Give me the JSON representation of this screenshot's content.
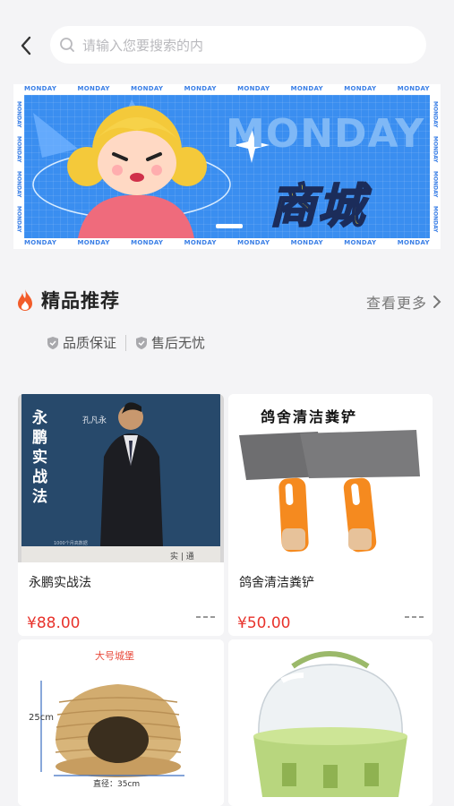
{
  "search": {
    "placeholder": "请输入您要搜索的内"
  },
  "banner": {
    "strip_word": "MONDAY",
    "headline": "MONDAY",
    "title": "商城"
  },
  "section": {
    "title": "精品推荐",
    "see_more": "查看更多",
    "badges": [
      "品质保证",
      "售后无忧"
    ]
  },
  "products": [
    {
      "name": "永鹏实战法",
      "price": "¥88.00",
      "cover_title": "永鹏实战法",
      "cover_author": "孔凡永",
      "cover_bottom": "实 | 通"
    },
    {
      "name": "鸽舍清洁粪铲",
      "price": "¥50.00",
      "cover_title": "鸽舍清洁粪铲"
    },
    {
      "name": "",
      "price": "",
      "cover_title": "大号城堡",
      "dim_height": "25cm",
      "dim_diameter": "直径：35cm"
    },
    {
      "name": "",
      "price": ""
    }
  ],
  "colors": {
    "price": "#e8332c",
    "banner_blue": "#3a8ef0",
    "banner_yellow": "#f4e02a",
    "flame": "#f25c2a"
  }
}
